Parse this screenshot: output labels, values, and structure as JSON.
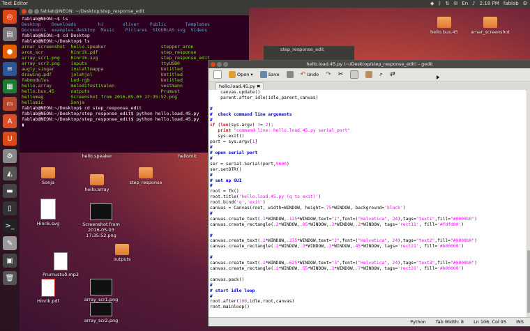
{
  "topbar": {
    "app_title": "Text Editor",
    "time": "2:18 PM",
    "user": "fablab"
  },
  "terminal": {
    "title": "fablab@NEON: ~/Desktop/step_response_edit",
    "lines": [
      "fablab@NEON:~$ ls",
      "Desktop    Downloads        hi       oliver    Public       Templates",
      "Documents  examples.desktop  Music    Pictures  SIGURLAS.svg  Videos",
      "fablab@NEON:~$ cd Desktop",
      "fablab@NEON:~/Desktop$ ls",
      "arnar_screenshot  hello.speaker                    stepper_aron",
      "aron_scr          Hinrik.pdf                       step_response",
      "array_scr1.png    Hinrik.svg                       step_response_edit",
      "array_scr2.png    inputs                           ttyUSB0",
      "augly_singar      installmappa                     Untitled",
      "drawing.pdf       jolahjol                         Untitled",
      "fabmodules        Led-rgb                          Untitled",
      "hello.array       melodifestivalen                 vestmann",
      "hello.bus.45      outputs                          Prumust",
      "hellomag          Screenshot from 2016-05-03 17:35:52.png",
      "hellomic          Sonja",
      "fablab@NEON:~/Desktop$ cd step_response_edit",
      "fablab@NEON:~/Desktop/step_response_edit$ python hello.load.45.py",
      "fablab@NEON:~/Desktop/step_response_edit$ python hello.load.45.py",
      "▮"
    ]
  },
  "bg_window": {
    "title": "step_response_edit"
  },
  "gedit": {
    "title": "hello.load.45.py (~/Desktop/step_response_edit) - gedit",
    "toolbar": {
      "open": "Open",
      "save": "Save",
      "undo": "Undo"
    },
    "tab": "hello.load.45.py",
    "status": {
      "lang": "Python",
      "tab": "Tab Width: 8",
      "pos": "Ln 106, Col 95",
      "mode": "INS"
    }
  },
  "desktop": {
    "icons": [
      "hello.bus.45",
      "arnar_screenshot",
      "hello.speaker",
      "hellomic",
      "Sonja",
      "hello.array",
      "step_response",
      "Hinrik.svg",
      "Screenshot from 2016-05-03 17:35:52.png",
      "Prumustuð.mp3",
      "outputs",
      "Hinrik.pdf",
      "array_scr1.png",
      "array_scr2.png"
    ]
  },
  "colors": {
    "terminal_bg": "#2c001e",
    "accent": "#dd4814"
  }
}
